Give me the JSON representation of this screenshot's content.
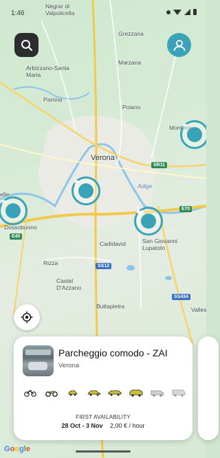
{
  "status": {
    "time": "1:46"
  },
  "map": {
    "labels": {
      "negrar": "Negrar di\nValpolicella",
      "grezzana": "Grezzana",
      "arbizzano": "Arbizzano-Santa\nMaria",
      "marzana": "Marzana",
      "parona": "Parona",
      "poiano": "Poiano",
      "montorio": "Montorio",
      "verona": "Verona",
      "sr11": "SR11",
      "adige": "Adige",
      "castel": "Castel",
      "dossobuono": "Dossobuono",
      "e70": "E70",
      "cadidavid": "Cadidavid",
      "sangiovanni": "San Giovanni\nLupatoto",
      "e45": "E45",
      "rizza": "Rizza",
      "ss12": "SS12",
      "casteldazzano": "Castel\nD'Azzano",
      "ss434": "SS434",
      "buttapietra": "Buttapietra",
      "vallese": "Valles"
    }
  },
  "card": {
    "title": "Parcheggio comodo - ZAI",
    "subtitle": "Verona",
    "availability_label": "FIRST AVAILABILITY",
    "availability_dates": "28 Oct - 3 Nov",
    "price": "2,00 € / hour",
    "vehicles": [
      "bicycle-icon",
      "motorbike-icon",
      "small-car-icon",
      "car-icon",
      "large-car-icon",
      "suv-icon",
      "van-icon",
      "camper-icon"
    ]
  },
  "colors": {
    "accent": "#3ba3b8",
    "dark_button": "#2b2d2f"
  },
  "google": "Google"
}
